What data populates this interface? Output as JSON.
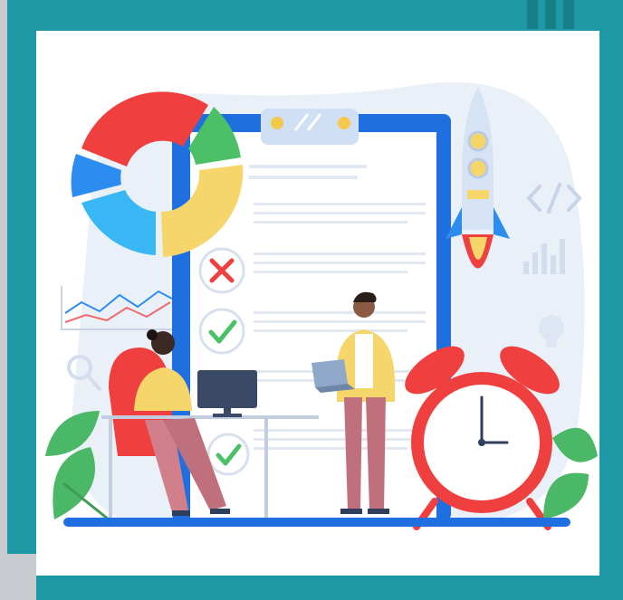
{
  "image": {
    "alt_subject": "project-planning-illustration",
    "scene_icons": [
      "pie-chart-icon",
      "clipboard-icon",
      "checkmark-icon",
      "cross-icon",
      "rocket-icon",
      "alarm-clock-icon",
      "laptop-icon",
      "computer-monitor-icon",
      "code-brackets-icon",
      "bar-chart-icon",
      "light-bulb-icon",
      "magnifier-icon",
      "line-chart-icon",
      "plant-icon"
    ]
  },
  "colors": {
    "frame": "#1e98a4",
    "frame_dark": "#157e88",
    "background": "#ffffff",
    "soft_blob": "#eaf0f8",
    "board_blue": "#1f6fe0",
    "paper": "#ffffff",
    "pie_red": "#ef3f3f",
    "pie_green": "#4cc066",
    "pie_yellow": "#f6d56a",
    "pie_blue": "#2d8cf0",
    "pie_light_blue": "#39b7f5",
    "clock_red": "#ef3f3f",
    "plant_green": "#4ab866",
    "floor_blue": "#1f6fe0"
  }
}
